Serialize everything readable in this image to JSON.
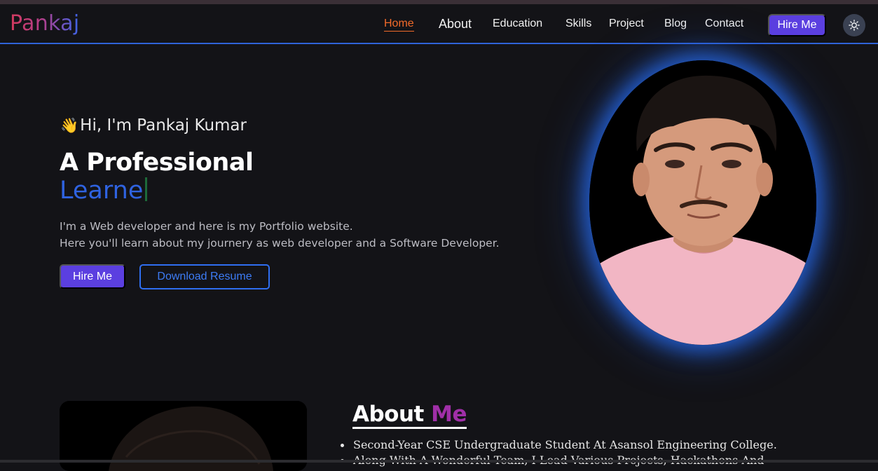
{
  "header": {
    "logo": "Pankaj",
    "nav": [
      {
        "label": "Home",
        "active": true
      },
      {
        "label": "About"
      },
      {
        "label": "Education"
      },
      {
        "label": "Skills"
      },
      {
        "label": "Project"
      },
      {
        "label": "Blog"
      },
      {
        "label": "Contact"
      }
    ],
    "hire_button": "Hire Me",
    "theme_toggle_icon": "sun-icon"
  },
  "hero": {
    "wave_icon": "👋",
    "greeting": "Hi, I'm Pankaj Kumar",
    "title": "A Professional",
    "typed_text": "Learne",
    "description_line1": "I'm a Web developer and here is my Portfolio website.",
    "description_line2": "Here you'll learn about my journery as web developer and a Software Developer.",
    "hire_button": "Hire Me",
    "resume_button": "Download Resume"
  },
  "about": {
    "heading_main": "About",
    "heading_accent": "Me",
    "items": [
      "Second-Year CSE Undergraduate Student At Asansol Engineering College.",
      "Along With A Wonderful Team, I Lead Various Projects, Hackathons And"
    ]
  },
  "colors": {
    "background": "#131317",
    "accent_blue": "#2f63e0",
    "accent_purple": "#5b3fe0",
    "nav_active": "#f26b2a",
    "about_accent": "#a02fa8"
  }
}
